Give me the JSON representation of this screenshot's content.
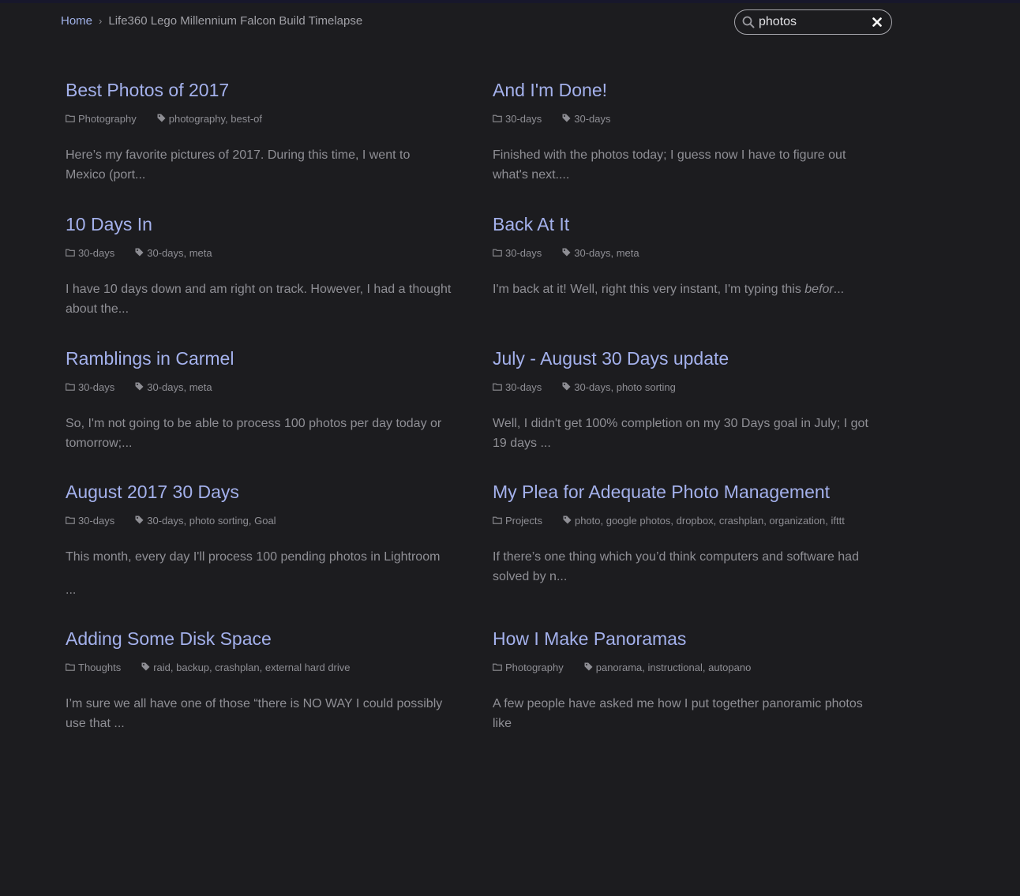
{
  "breadcrumb": {
    "home": "Home",
    "separator": "›",
    "current": "Life360 Lego Millennium Falcon Build Timelapse"
  },
  "search": {
    "value": "photos",
    "placeholder": ""
  },
  "posts": [
    {
      "title": "Best Photos of 2017",
      "category": "Photography",
      "tags": "photography, best-of",
      "excerpt": "Here’s my favorite pictures of 2017. During this time, I went to Mexico (port..."
    },
    {
      "title": "And I'm Done!",
      "category": "30-days",
      "tags": "30-days",
      "excerpt": "Finished with the photos today; I guess now I have to figure out what's next...."
    },
    {
      "title": "10 Days In",
      "category": "30-days",
      "tags": "30-days, meta",
      "excerpt": "I have 10 days down and am right on track. However, I had a thought about the..."
    },
    {
      "title": "Back At It",
      "category": "30-days",
      "tags": "30-days, meta",
      "excerpt_pre": "I'm back at it! Well, right this very instant, I'm typing this ",
      "excerpt_em": "befor",
      "excerpt_post": "..."
    },
    {
      "title": "Ramblings in Carmel",
      "category": "30-days",
      "tags": "30-days, meta",
      "excerpt": "So, I'm not going to be able to process 100 photos per day today or tomorrow;..."
    },
    {
      "title": "July - August 30 Days update",
      "category": "30-days",
      "tags": "30-days, photo sorting",
      "excerpt": "Well, I didn't get 100% completion on my 30 Days goal in July; I got 19 days ..."
    },
    {
      "title": "August 2017 30 Days",
      "category": "30-days",
      "tags": "30-days, photo sorting, Goal",
      "excerpt": "This month, every day I'll process 100 pending photos in Lightroom",
      "excerpt_extra": "..."
    },
    {
      "title": "My Plea for Adequate Photo Management",
      "category": "Projects",
      "tags": "photo, google photos, dropbox, crashplan, organization, ifttt",
      "excerpt": "If there’s one thing which you’d think computers and software had solved by n..."
    },
    {
      "title": "Adding Some Disk Space",
      "category": "Thoughts",
      "tags": "raid, backup, crashplan, external hard drive",
      "excerpt": "I’m sure we all have one of those “there is NO WAY I could possibly use that ..."
    },
    {
      "title": "How I Make Panoramas",
      "category": "Photography",
      "tags": "panorama, instructional, autopano",
      "excerpt": "A few people have asked me how I put together panoramic photos like"
    }
  ],
  "colors": {
    "background": "#1c1c1f",
    "link": "#a4b1ec",
    "text": "#8f8f95"
  }
}
